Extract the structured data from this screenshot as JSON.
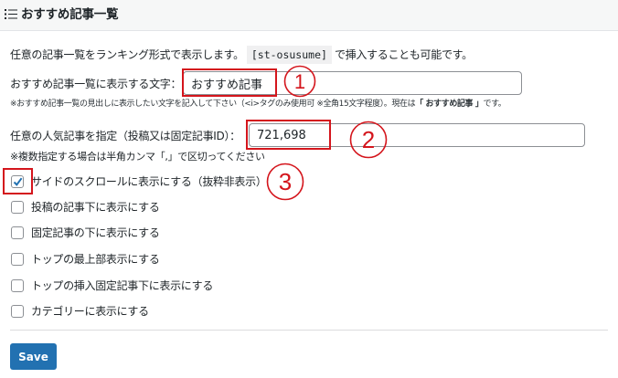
{
  "header": {
    "title": "おすすめ記事一覧",
    "icon": "list-icon"
  },
  "description": {
    "before": "任意の記事一覧をランキング形式で表示します。",
    "shortcode": "[st-osusume]",
    "after": "で挿入することも可能です。"
  },
  "title_field": {
    "label": "おすすめ記事一覧に表示する文字：",
    "value": "おすすめ記事",
    "note_before": "※おすすめ記事一覧の見出しに表示したい文字を記入して下さい（<i>タグのみ使用可 ※全角15文字程度）。現在は",
    "note_current": "「 おすすめ記事 」",
    "note_after": "です。"
  },
  "ids_field": {
    "label": "任意の人気記事を指定（投稿又は固定記事ID）：",
    "value": "721,698",
    "note": "※複数指定する場合は半角カンマ「,」で区切ってください"
  },
  "options": [
    {
      "label": "サイドのスクロールに表示にする（抜粋非表示）",
      "checked": true
    },
    {
      "label": "投稿の記事下に表示にする",
      "checked": false
    },
    {
      "label": "固定記事の下に表示にする",
      "checked": false
    },
    {
      "label": "トップの最上部表示にする",
      "checked": false
    },
    {
      "label": "トップの挿入固定記事下に表示にする",
      "checked": false
    },
    {
      "label": "カテゴリーに表示にする",
      "checked": false
    }
  ],
  "annotations": {
    "one": "①",
    "two": "②",
    "three": "③",
    "color": "#d4151c"
  },
  "save": {
    "label": "Save",
    "color": "#2271b1"
  }
}
